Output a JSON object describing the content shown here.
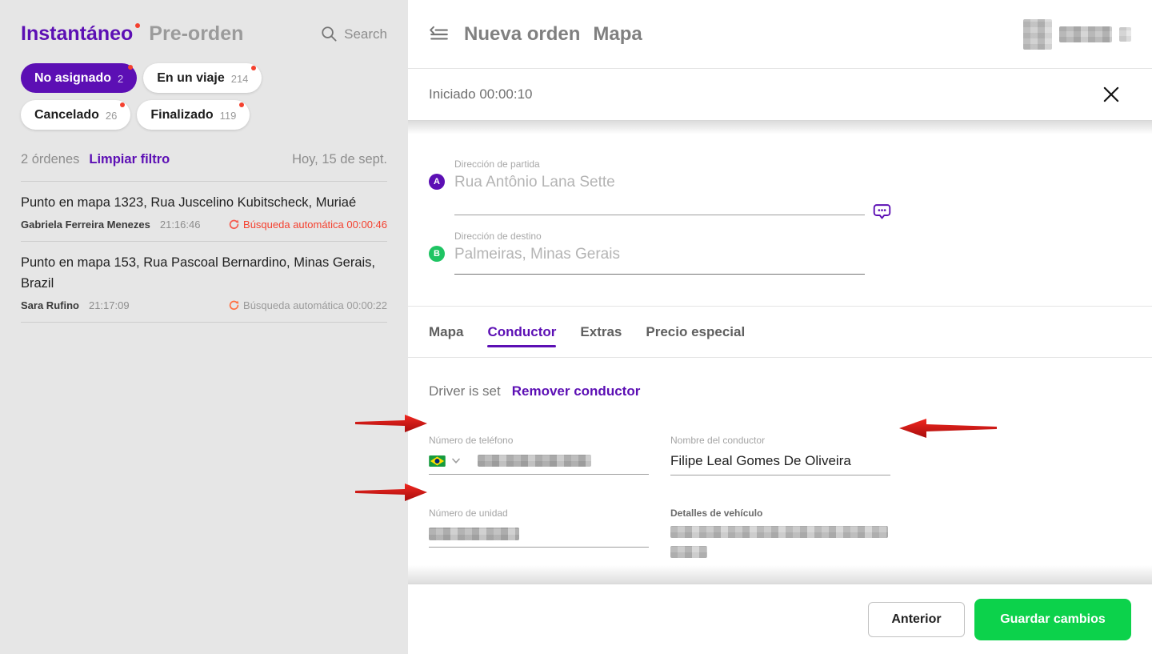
{
  "colors": {
    "accent_purple": "#5c0fb4",
    "save_green": "#0cd24b",
    "badge_green": "#1fc463",
    "alert_red": "#f4402e",
    "spinner_orange": "#ff7043",
    "sidebar_bg": "#e6e6e6"
  },
  "sidebar": {
    "brand": {
      "primary": "Instantáneo",
      "secondary": "Pre-orden"
    },
    "search": {
      "label": "Search",
      "icon": "search-icon"
    },
    "filters": [
      {
        "label": "No asignado",
        "count": "2",
        "active": true
      },
      {
        "label": "En un viaje",
        "count": "214",
        "active": false
      },
      {
        "label": "Cancelado",
        "count": "26",
        "active": false
      },
      {
        "label": "Finalizado",
        "count": "119",
        "active": false
      }
    ],
    "summary": {
      "count_text": "2 órdenes",
      "clear_filter": "Limpiar filtro",
      "date": "Hoy, 15 de sept."
    },
    "orders": [
      {
        "title": "Punto en mapa 1323, Rua Juscelino Kubitscheck, Muriaé",
        "client": "Gabriela Ferreira Menezes",
        "time": "21:16:46",
        "auto_search": "Búsqueda automática 00:00:46",
        "status_style": "red"
      },
      {
        "title": "Punto en mapa 153, Rua Pascoal Bernardino, Minas Gerais, Brazil",
        "client": "Sara Rufino",
        "time": "21:17:09",
        "auto_search": "Búsqueda automática 00:00:22",
        "status_style": "gray"
      }
    ]
  },
  "panel": {
    "title": "Nueva orden",
    "title_secondary": "Mapa",
    "status": "Iniciado 00:00:10",
    "route": {
      "from_label": "Dirección de partida",
      "from_value": "Rua Antônio Lana Sette",
      "from_badge": "A",
      "to_label": "Dirección de destino",
      "to_value": "Palmeiras, Minas Gerais",
      "to_badge": "B"
    },
    "tabs": [
      {
        "label": "Mapa",
        "active": false
      },
      {
        "label": "Conductor",
        "active": true
      },
      {
        "label": "Extras",
        "active": false
      },
      {
        "label": "Precio especial",
        "active": false
      }
    ],
    "driver": {
      "status": "Driver is set",
      "remove": "Remover conductor",
      "phone_label": "Número de teléfono",
      "phone_flag": "brazil-flag",
      "name_label": "Nombre del conductor",
      "name_value": "Filipe Leal Gomes De Oliveira",
      "unit_label": "Número de unidad",
      "vehicle_label": "Detalles de vehículo"
    },
    "footer": {
      "back": "Anterior",
      "save": "Guardar cambios"
    }
  }
}
